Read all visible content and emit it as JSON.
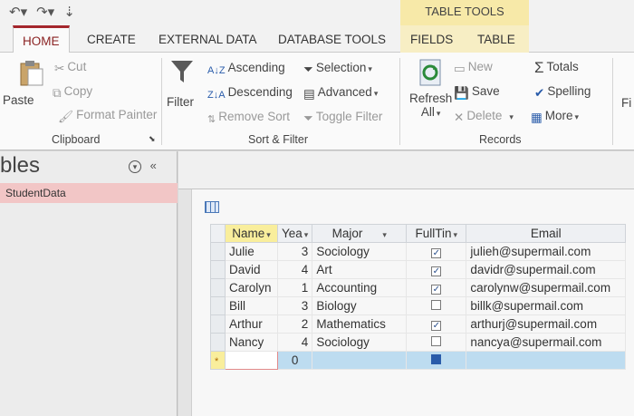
{
  "title_bar": {
    "context_tab_group": "TABLE TOOLS"
  },
  "tabs": [
    {
      "label": "HOME",
      "active": true
    },
    {
      "label": "CREATE"
    },
    {
      "label": "EXTERNAL DATA"
    },
    {
      "label": "DATABASE TOOLS"
    },
    {
      "label": "FIELDS"
    },
    {
      "label": "TABLE"
    }
  ],
  "ribbon": {
    "clipboard": {
      "group": "Clipboard",
      "paste": "Paste",
      "cut": "Cut",
      "copy": "Copy",
      "format_painter": "Format Painter"
    },
    "sort_filter": {
      "group": "Sort & Filter",
      "filter": "Filter",
      "ascending": "Ascending",
      "descending": "Descending",
      "remove_sort": "Remove Sort",
      "selection": "Selection",
      "advanced": "Advanced",
      "toggle_filter": "Toggle Filter"
    },
    "records": {
      "group": "Records",
      "refresh": "Refresh",
      "refresh_all": "All",
      "new": "New",
      "save": "Save",
      "delete": "Delete",
      "totals": "Totals",
      "spelling": "Spelling",
      "more": "More",
      "find_cut": "Fi"
    }
  },
  "nav": {
    "title": "bles",
    "items": [
      "StudentData"
    ]
  },
  "table": {
    "columns": [
      "Name",
      "Yea",
      "Major",
      "FullTin",
      "Email"
    ],
    "rows": [
      {
        "name": "Julie",
        "year": "3",
        "major": "Sociology",
        "fulltime": true,
        "email": "julieh@supermail.com"
      },
      {
        "name": "David",
        "year": "4",
        "major": "Art",
        "fulltime": true,
        "email": "davidr@supermail.com"
      },
      {
        "name": "Carolyn",
        "year": "1",
        "major": "Accounting",
        "fulltime": true,
        "email": "carolynw@supermail.com"
      },
      {
        "name": "Bill",
        "year": "3",
        "major": "Biology",
        "fulltime": false,
        "email": "billk@supermail.com"
      },
      {
        "name": "Arthur",
        "year": "2",
        "major": "Mathematics",
        "fulltime": true,
        "email": "arthurj@supermail.com"
      },
      {
        "name": "Nancy",
        "year": "4",
        "major": "Sociology",
        "fulltime": false,
        "email": "nancya@supermail.com"
      }
    ],
    "new_row": {
      "marker": "*",
      "year": "0"
    }
  },
  "colors": {
    "accent": "#a4262c",
    "context_tab": "#f7e9a8",
    "nav_selected": "#f2c6c6",
    "new_row": "#bddcf0"
  }
}
